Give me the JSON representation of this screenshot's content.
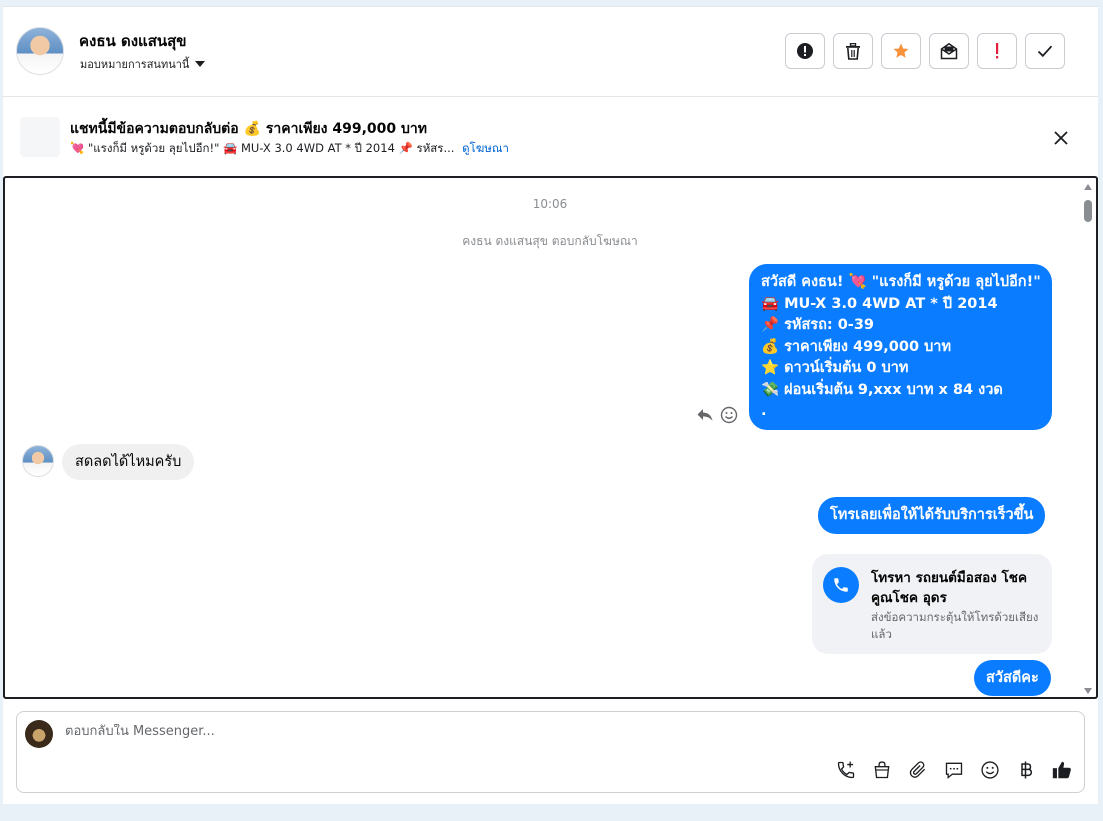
{
  "header": {
    "contact_name": "คงธน ดงแสนสุข",
    "assign_label": "มอบหมายการสนทนานี้"
  },
  "ad": {
    "title": "แชทนี้มีข้อความตอบกลับต่อ 💰 ราคาเพียง 499,000 บาท",
    "subtitle": "💘 \"แรงก็มี หรูด้วย ลุยไปอีก!\" 🚘 MU-X 3.0 4WD AT * ปี 2014 📌 รหัสร...",
    "link": "ดูโฆษณา"
  },
  "chat": {
    "timestamp": "10:06",
    "system_note": "คงธน ดงแสนสุข ตอบกลับโฆษณา",
    "outgoing_1": [
      "สวัสดี คงธน! 💘 \"แรงก็มี หรูด้วย ลุยไปอีก!\"",
      "🚘 MU-X 3.0 4WD AT * ปี 2014",
      "📌 รหัสรถ: 0-39",
      "💰 ราคาเพียง 499,000 บาท",
      "⭐ ดาวน์เริ่มต้น 0 บาท",
      "💸 ผ่อนเริ่มต้น 9,xxx บาท x 84 งวด",
      "."
    ],
    "incoming_1": "สดลดได้ไหมครับ",
    "outgoing_2": "โทรเลยเพื่อให้ได้รับบริการเร็วขึ้น",
    "call_card": {
      "title": "โทรหา รถยนต์มือสอง โชคคูณโชค อุดร",
      "subtitle": "ส่งข้อความกระตุ้นให้โทรด้วยเสียงแล้ว"
    },
    "outgoing_3": "สวัสดีคะ"
  },
  "composer": {
    "placeholder": "ตอบกลับใน Messenger..."
  },
  "colors": {
    "accent": "#0a7cff",
    "star": "#f7923b",
    "alert": "#e41e3f"
  }
}
